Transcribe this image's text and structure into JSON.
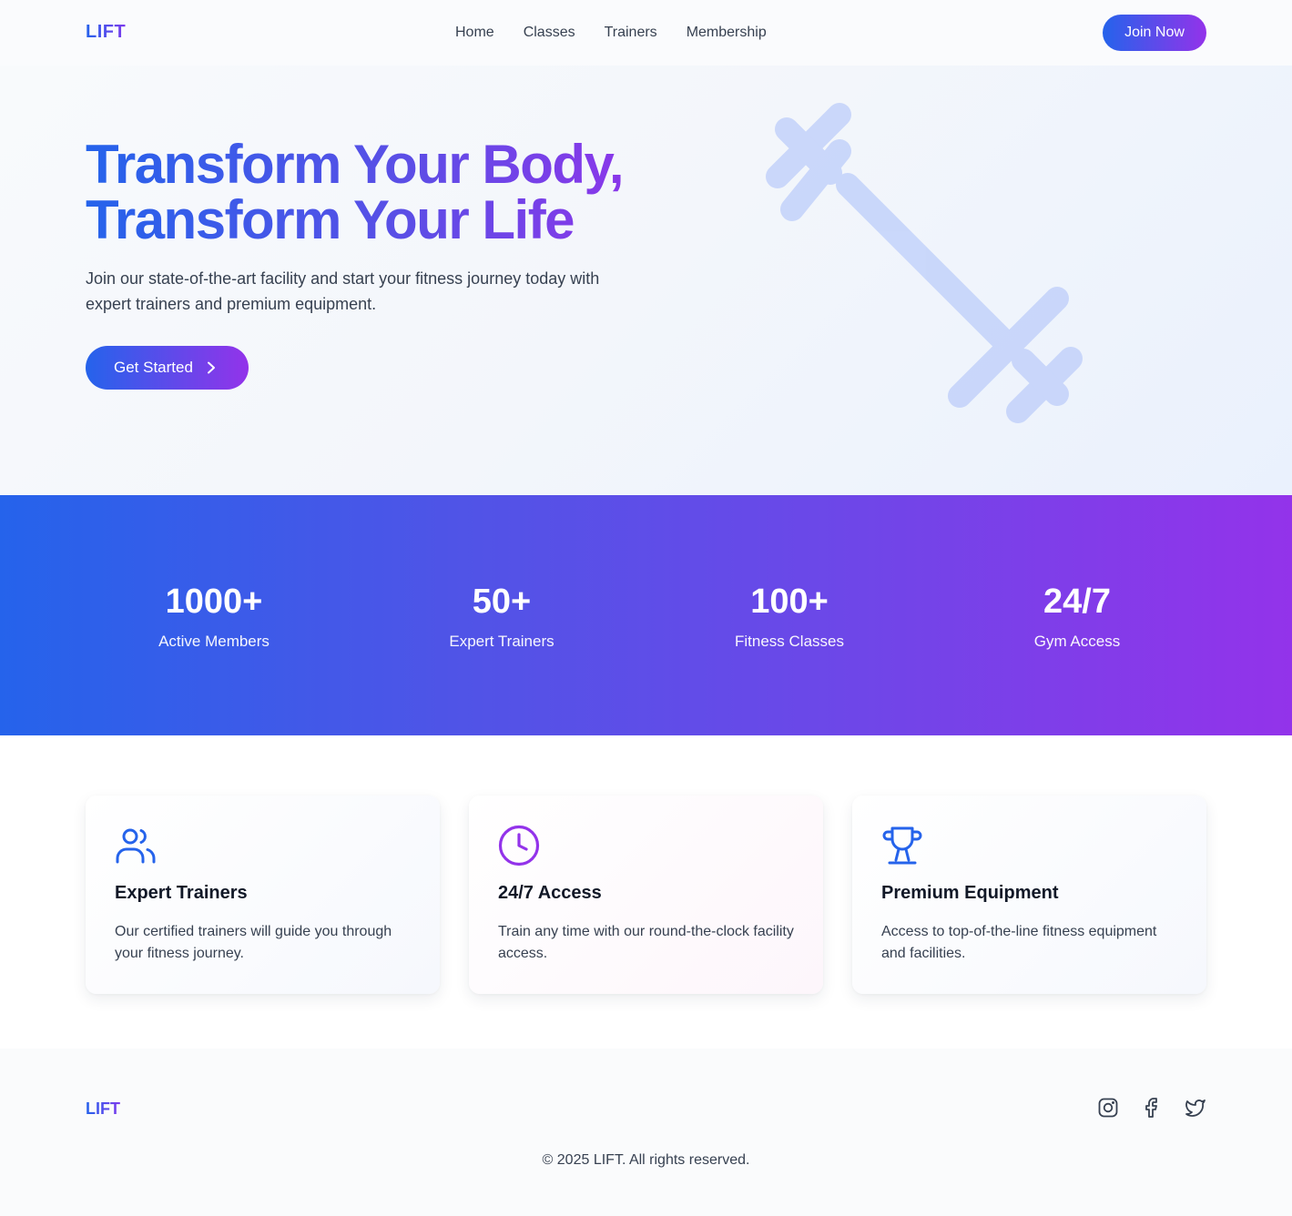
{
  "brand": {
    "name": "LIFT"
  },
  "nav": {
    "items": [
      {
        "label": "Home"
      },
      {
        "label": "Classes"
      },
      {
        "label": "Trainers"
      },
      {
        "label": "Membership"
      }
    ],
    "join_label": "Join Now"
  },
  "hero": {
    "title_line1": "Transform Your Body,",
    "title_line2": "Transform Your Life",
    "subtitle": "Join our state-of-the-art facility and start your fitness journey today with expert trainers and premium equipment.",
    "cta_label": "Get Started",
    "decor_icon": "dumbbell-icon"
  },
  "stats": [
    {
      "value": "1000+",
      "label": "Active Members"
    },
    {
      "value": "50+",
      "label": "Expert Trainers"
    },
    {
      "value": "100+",
      "label": "Fitness Classes"
    },
    {
      "value": "24/7",
      "label": "Gym Access"
    }
  ],
  "features": [
    {
      "icon": "users-icon",
      "icon_color": "#2563eb",
      "title": "Expert Trainers",
      "text": "Our certified trainers will guide you through your fitness journey."
    },
    {
      "icon": "clock-icon",
      "icon_color": "#9333ea",
      "title": "24/7 Access",
      "text": "Train any time with our round-the-clock facility access."
    },
    {
      "icon": "trophy-icon",
      "icon_color": "#2563eb",
      "title": "Premium Equipment",
      "text": "Access to top-of-the-line fitness equipment and facilities."
    }
  ],
  "footer": {
    "logo": "LIFT",
    "social": [
      "instagram-icon",
      "facebook-icon",
      "twitter-icon"
    ],
    "copyright": "© 2025 LIFT. All rights reserved."
  },
  "colors": {
    "accent_blue": "#2563eb",
    "accent_purple": "#9333ea"
  }
}
